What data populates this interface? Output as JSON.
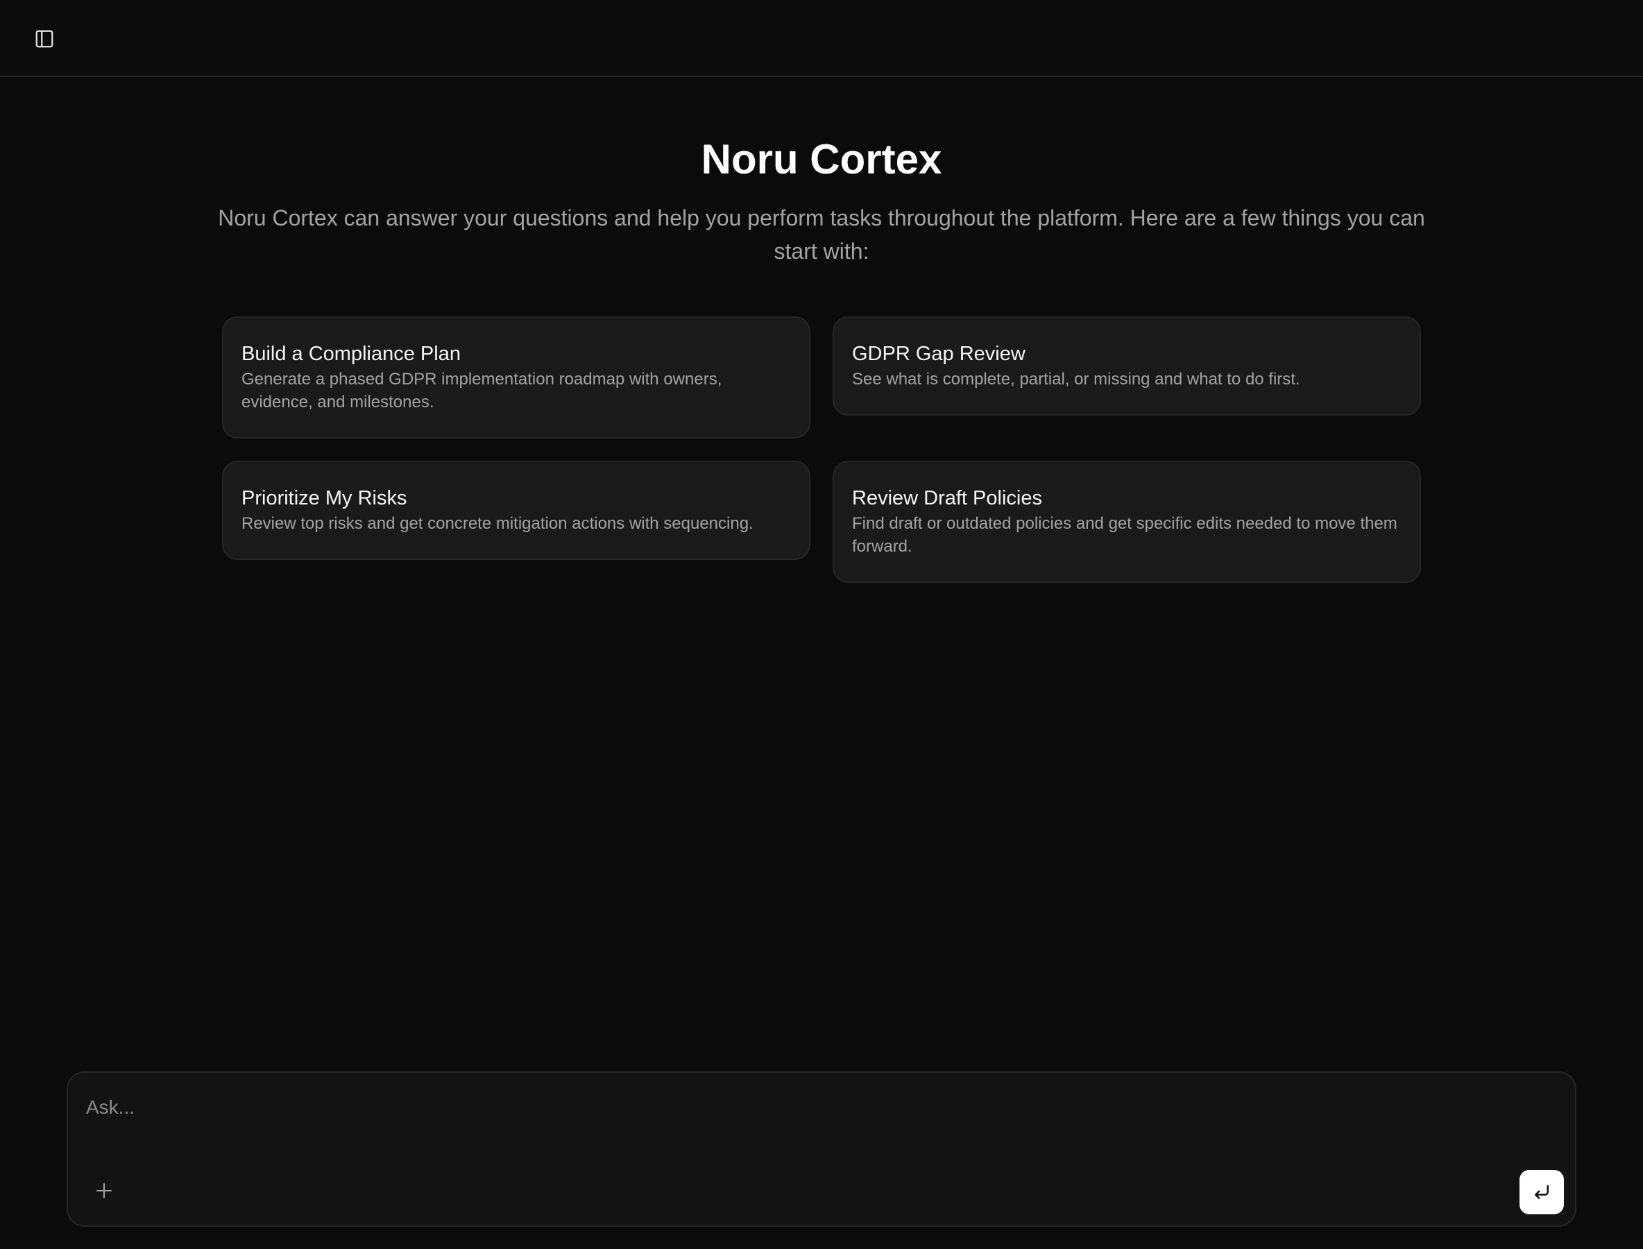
{
  "header": {
    "sidebar_toggle_icon": "sidebar-panel-icon"
  },
  "hero": {
    "title": "Noru Cortex",
    "subtitle": "Noru Cortex can answer your questions and help you perform tasks throughout the platform. Here are a few things you can start with:"
  },
  "suggestions": [
    {
      "title": "Build a Compliance Plan",
      "description": "Generate a phased GDPR implementation roadmap with owners, evidence, and milestones."
    },
    {
      "title": "GDPR Gap Review",
      "description": "See what is complete, partial, or missing and what to do first."
    },
    {
      "title": "Prioritize My Risks",
      "description": "Review top risks and get concrete mitigation actions with sequencing."
    },
    {
      "title": "Review Draft Policies",
      "description": "Find draft or outdated policies and get specific edits needed to move them forward."
    }
  ],
  "composer": {
    "placeholder": "Ask...",
    "value": "",
    "attach_icon": "plus-icon",
    "submit_icon": "enter-return-icon"
  },
  "colors": {
    "background": "#0b0b0b",
    "card_background": "#1a1a1a",
    "card_border": "#262626",
    "muted_text": "#a3a3a3",
    "submit_button": "#ffffff"
  }
}
